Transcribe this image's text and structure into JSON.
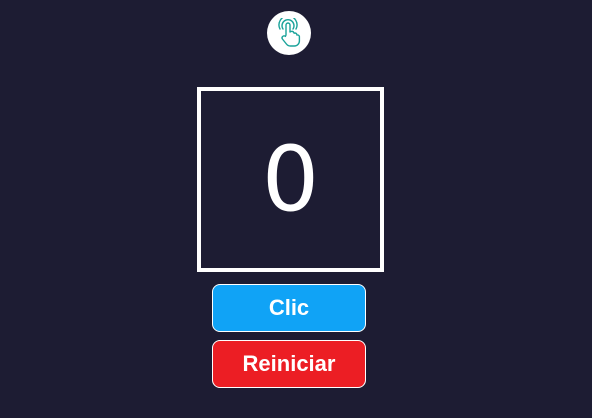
{
  "logo": {
    "icon": "pointer-hand-tap-icon",
    "color": "#1aa39a"
  },
  "counter": {
    "value": "0"
  },
  "buttons": {
    "click_label": "Clic",
    "reset_label": "Reiniciar"
  },
  "colors": {
    "background": "#1d1c33",
    "click_button": "#10a3f6",
    "reset_button": "#ec1e24",
    "text": "#ffffff"
  }
}
